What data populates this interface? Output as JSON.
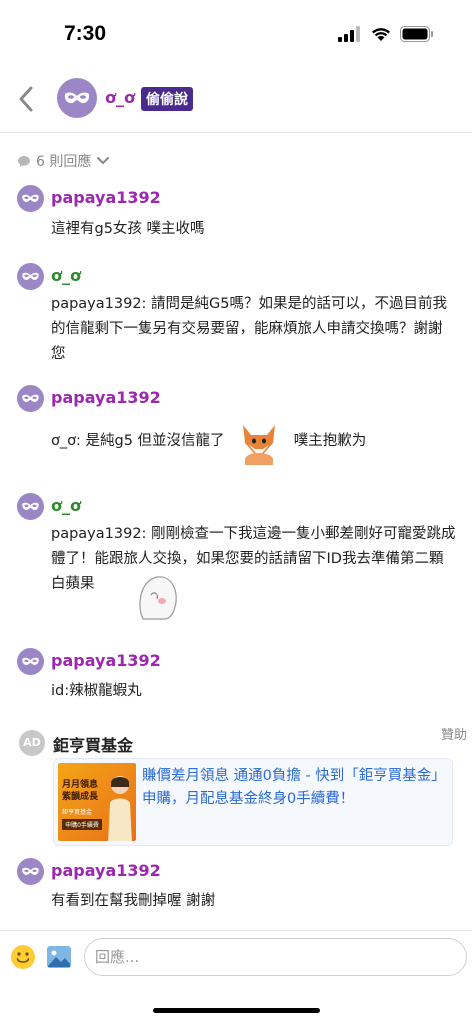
{
  "status_bar": {
    "time": "7:30"
  },
  "header": {
    "author_name": "ơ_ơ",
    "badge": "偷偷說"
  },
  "reply_count": "6 則回應",
  "comments": [
    {
      "author": "papaya1392",
      "text": "這裡有g5女孩 噗主收嗎"
    },
    {
      "author": "ơ_ơ",
      "text": "papaya1392: 請問是純G5嗎？如果是的話可以，不過目前我的信龍剩下一隻另有交易要留，能麻煩旅人申請交換嗎？謝謝您"
    },
    {
      "author": "papaya1392",
      "text_before": "ơ_ơ: 是純g5 但並沒信龍了",
      "text_after": "噗主抱歉为"
    },
    {
      "author": "ơ_ơ",
      "text": "papaya1392: 剛剛檢查一下我這邊一隻小郵差剛好可寵愛跳成體了！能跟旅人交換，如果您要的話請留下ID我去準備第二顆白蘋果"
    },
    {
      "author": "papaya1392",
      "text": "id:辣椒龍蝦丸"
    },
    {
      "author": "papaya1392",
      "text": "有看到在幫我刪掉喔 謝謝"
    }
  ],
  "ad": {
    "avatar_initials": "AD",
    "advertiser": "鉅亨買基金",
    "sponsored_label": "贊助",
    "text": "賺價差月領息  通通0負擔 - 快到「鉅亨買基金」申購，月配息基金終身0手續費！",
    "thumb_title": "月月領息 紫韻成長",
    "thumb_sub": "鉅亨買基金",
    "thumb_button": "申購0手續費"
  },
  "composer": {
    "placeholder": "回應..."
  },
  "colors": {
    "purple_name": "#9c27b0",
    "green_name": "#2e8b2e",
    "badge_bg": "#4a2a8c",
    "avatar_bg": "#9b86c6",
    "link_blue": "#2b6bd6"
  }
}
